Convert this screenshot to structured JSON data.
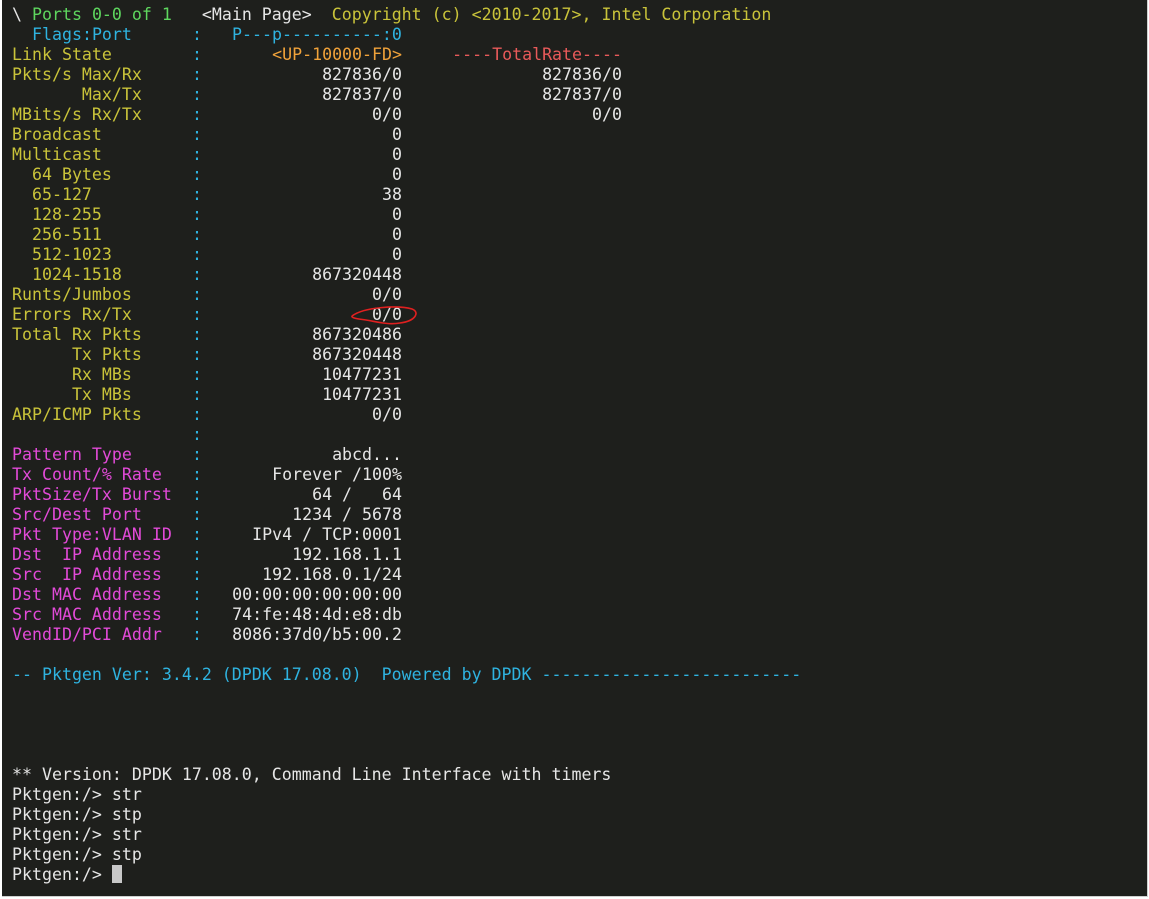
{
  "header": {
    "spinner": "\\",
    "ports": "Ports 0-0 of 1",
    "page": "<Main Page>",
    "copyright": "Copyright (c) <2010-2017>, Intel Corporation"
  },
  "flags": {
    "label": "Flags:Port",
    "sep": ":",
    "value": "P---p----------:0"
  },
  "link_state": {
    "label": "Link State",
    "sep": ":",
    "port0": "<UP-10000-FD>",
    "total": "----TotalRate----"
  },
  "stats": [
    {
      "label": "Pkts/s Max/Rx",
      "sep": ":",
      "port0": "827836/0",
      "total": "827836/0"
    },
    {
      "label": "       Max/Tx",
      "sep": ":",
      "port0": "827837/0",
      "total": "827837/0"
    },
    {
      "label": "MBits/s Rx/Tx",
      "sep": ":",
      "port0": "0/0",
      "total": "0/0"
    },
    {
      "label": "Broadcast",
      "sep": ":",
      "port0": "0",
      "total": ""
    },
    {
      "label": "Multicast",
      "sep": ":",
      "port0": "0",
      "total": ""
    },
    {
      "label": "  64 Bytes",
      "sep": ":",
      "port0": "0",
      "total": ""
    },
    {
      "label": "  65-127",
      "sep": ":",
      "port0": "38",
      "total": ""
    },
    {
      "label": "  128-255",
      "sep": ":",
      "port0": "0",
      "total": ""
    },
    {
      "label": "  256-511",
      "sep": ":",
      "port0": "0",
      "total": ""
    },
    {
      "label": "  512-1023",
      "sep": ":",
      "port0": "0",
      "total": ""
    },
    {
      "label": "  1024-1518",
      "sep": ":",
      "port0": "867320448",
      "total": ""
    },
    {
      "label": "Runts/Jumbos",
      "sep": ":",
      "port0": "0/0",
      "total": ""
    },
    {
      "label": "Errors Rx/Tx",
      "sep": ":",
      "port0": "0/0",
      "total": ""
    },
    {
      "label": "Total Rx Pkts",
      "sep": ":",
      "port0": "867320486",
      "total": ""
    },
    {
      "label": "      Tx Pkts",
      "sep": ":",
      "port0": "867320448",
      "total": ""
    },
    {
      "label": "      Rx MBs",
      "sep": ":",
      "port0": "10477231",
      "total": ""
    },
    {
      "label": "      Tx MBs",
      "sep": ":",
      "port0": "10477231",
      "total": ""
    },
    {
      "label": "ARP/ICMP Pkts",
      "sep": ":",
      "port0": "0/0",
      "total": ""
    },
    {
      "label": "",
      "sep": ":",
      "port0": "",
      "total": ""
    }
  ],
  "config": [
    {
      "label": "Pattern Type",
      "sep": ":",
      "value": "abcd..."
    },
    {
      "label": "Tx Count/% Rate",
      "sep": ":",
      "value": "Forever /100%"
    },
    {
      "label": "PktSize/Tx Burst",
      "sep": ":",
      "value": "64 /   64"
    },
    {
      "label": "Src/Dest Port",
      "sep": ":",
      "value": "1234 / 5678"
    },
    {
      "label": "Pkt Type:VLAN ID",
      "sep": ":",
      "value": "IPv4 / TCP:0001"
    },
    {
      "label": "Dst  IP Address",
      "sep": ":",
      "value": "192.168.1.1"
    },
    {
      "label": "Src  IP Address",
      "sep": ":",
      "value": "192.168.0.1/24"
    },
    {
      "label": "Dst MAC Address",
      "sep": ":",
      "value": "00:00:00:00:00:00"
    },
    {
      "label": "Src MAC Address",
      "sep": ":",
      "value": "74:fe:48:4d:e8:db"
    },
    {
      "label": "VendID/PCI Addr",
      "sep": ":",
      "value": "8086:37d0/b5:00.2"
    }
  ],
  "footer": {
    "left": "-- Pktgen Ver: 3.4.2 (DPDK 17.08.0)",
    "right": "Powered by DPDK --------------------------"
  },
  "cli": {
    "version_line": "** Version: DPDK 17.08.0, Command Line Interface with timers",
    "history": [
      "Pktgen:/> str",
      "Pktgen:/> stp",
      "Pktgen:/> str",
      "Pktgen:/> stp"
    ],
    "prompt": "Pktgen:/> "
  },
  "colors": {
    "background": "#1e1f1c",
    "label_yellow": "#c9c33a",
    "label_magenta": "#e24ad8",
    "header_green": "#5ed65e",
    "separator_cyan": "#2fb3e0",
    "link_orange": "#f0a23a",
    "total_red": "#e85a5a",
    "annotation_red": "#e02020"
  }
}
